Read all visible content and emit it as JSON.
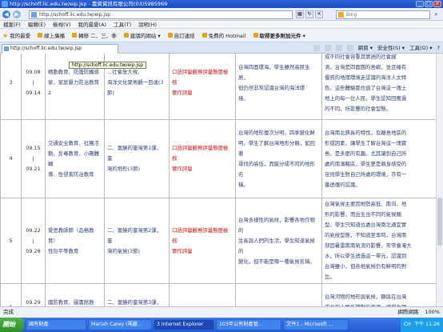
{
  "window": {
    "title": "http://schoff.lic.edu.tw/eip.jsp - 農資資訊有限公司(03)5985969"
  },
  "address": {
    "url": "http://schoff.lic.edu.tw/eip.jsp",
    "search_placeholder": "Bing"
  },
  "menu": [
    "檔案(F)",
    "編輯(E)",
    "檢視(V)",
    "我的最愛(A)",
    "工具(T)",
    "說明(H)"
  ],
  "favorites": {
    "label": "我的最愛",
    "items": [
      "線上廣播",
      "轉移 二、三、季",
      "建議的網站 ▾",
      "自訂連結",
      "免費的 Hotmail",
      "取得更多附加元件 ▾"
    ]
  },
  "tab": {
    "label": "http://schoff.lic.edu.tw/eip.jsp"
  },
  "commands": [
    "網頁 ▾",
    "安全性(S) ▾",
    "工具(O) ▾",
    "?"
  ],
  "tooltip": "http://schoff.lic.edu.tw/eip.jsp",
  "rows": [
    {
      "num": "3",
      "week": [
        "09.08",
        "|",
        "09.14"
      ],
      "topic": [
        "精動教育、防護防觸感",
        "家、家庭暴力防治教育2"
      ],
      "unit": [
        "...社會放大視、",
        "海洋文化聚術觀一目達(3",
        "節)"
      ],
      "assess": [
        "口語評量觀察評量態度檢核",
        "實作評量"
      ],
      "goal": [
        "台灣四面環海，學生雖然高原生居，",
        "但仍然非常認識台灣的海洋環",
        "境。"
      ],
      "desc": [
        "成不同社會容重其實週的社會經",
        "濟。台灣是四面圍的島嶼，並且擁有",
        "優質的地理環境走認識的海洋人文特",
        "色，這些體驗都也值了台灣這一塊土",
        "地上的每一位人民，學生認知回應過",
        "的不同，所影響的社會型態。"
      ]
    },
    {
      "num": "4",
      "week": [
        "09.15",
        "|",
        "09.21"
      ],
      "topic": [
        "交通安全教育、社團活",
        "動、反毒教育、小團體轉",
        "導、性侵害防治教育"
      ],
      "unit": [
        "二、富饒的臺灣第1課，臺",
        "灣的地形(3節)"
      ],
      "assess": [
        "口語評量觀察評量態度檢核",
        "實作評量"
      ],
      "goal": [
        "台灣的地形層次分明，四季變化鮮",
        "明，學生了解台灣地形分類，如回著",
        "尋找的高低，而能分成不同的地形名",
        "稱。"
      ],
      "desc": [
        "台灣南北狹長的特性，及離島地區的",
        "形成因素，讓學生了解台灣這一塊寶",
        "島，是多麼的有趣。尤其讓到自己所",
        "處的南濱轄區，學生更是親身感受的",
        "足見學生對自己所處的環境，亦有一",
        "番透徹的認識。"
      ]
    },
    {
      "num": "5",
      "week": [
        "09.22",
        "|",
        "09.28"
      ],
      "topic": [
        "愛思教師節（品格教育）",
        "性別平等教育"
      ],
      "unit": [
        "二、富饒的臺灣第2課，臺",
        "灣的氣候(3節)"
      ],
      "assess": [
        "口語評量觀察評量態度檢核",
        "實作評量"
      ],
      "goal": [
        "台灣多樣性的氣候，影響各地作物的",
        "生長與人們的生活，學生知道氣候的",
        "變化，但不能是哪一種氣候名稱。"
      ],
      "desc": [
        "台灣氣候主要因地勢高低、南向、地",
        "形的影響，而出生出不同的氣候類",
        "型，學生只知道位處台灣南北適宜實",
        "的氣候型態，不知道至率時，台灣南",
        "部回暑雷南南氣流的影響，常常會淹大",
        "水，所以學生透過這一單元，認識到",
        "台灣雖小，但各地氣候仍有鮮明的對",
        "比。"
      ]
    },
    {
      "num": "6",
      "week": [
        "09.29",
        "|",
        ""
      ],
      "topic": [
        "國防教育、圖書館教育、",
        ""
      ],
      "unit": [
        "二、富饒的臺灣第3課，臺",
        ""
      ],
      "assess": [
        "",
        ""
      ],
      "goal": [
        "",
        ""
      ],
      "desc": [
        "台灣河物的地形與氣候，顯與在台灣",
        "成長的人民所帶動的資源，讓學生理",
        "解台灣的豐富與資源之自然把握起來..."
      ]
    }
  ],
  "status": {
    "left": "完成",
    "zone": "網際網路",
    "zoom": "100%"
  },
  "taskbar": {
    "start": "開始",
    "buttons": [
      "國有財產",
      "Mariah Carey (瑪麗...",
      "3 Internet Explorer",
      "103年公有財產管...",
      "文件1 - Microsoft ..."
    ],
    "active_index": 2,
    "tray_lang": "CH",
    "clock": "下午 11:26"
  }
}
